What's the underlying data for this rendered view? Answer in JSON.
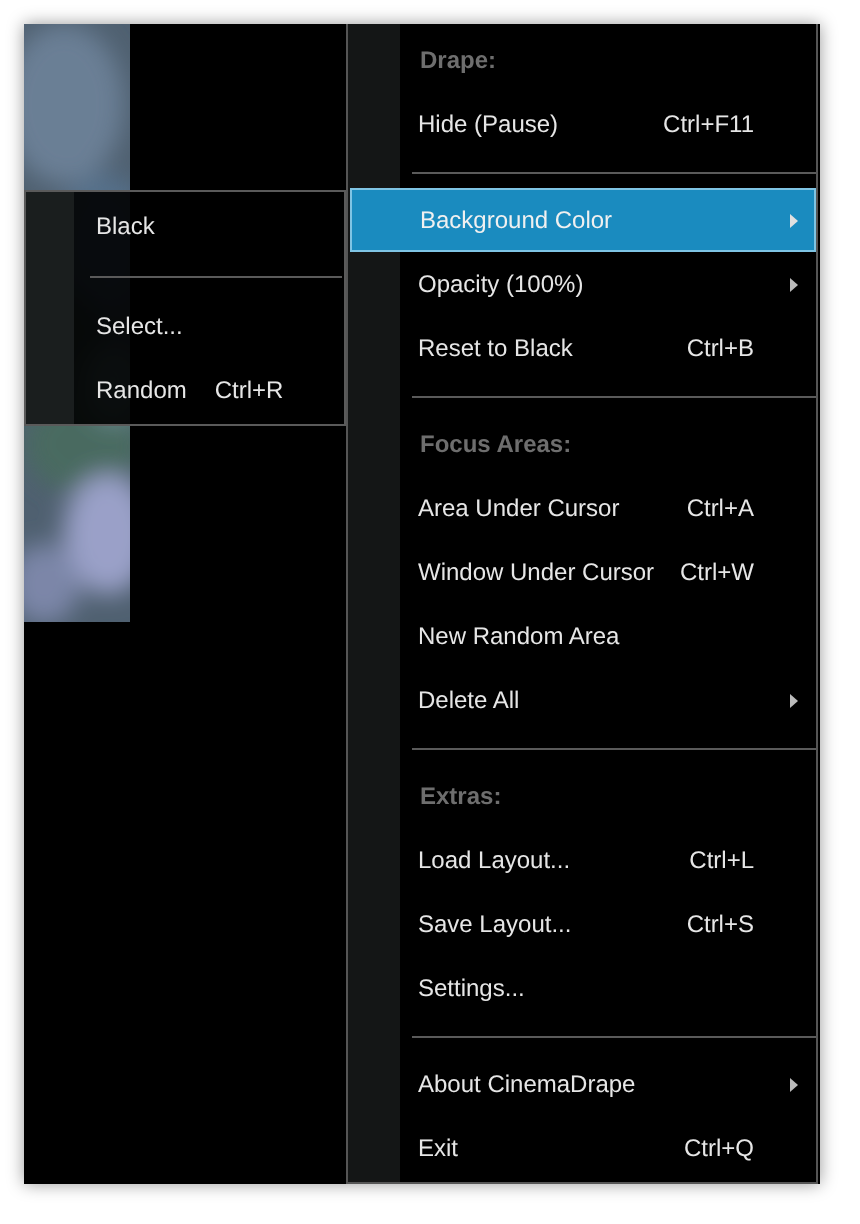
{
  "menu": [
    {
      "kind": "header",
      "label": "Drape:"
    },
    {
      "kind": "item",
      "label": "Hide (Pause)",
      "shortcut": "Ctrl+F11",
      "submenu": false,
      "selected": false
    },
    {
      "kind": "separator"
    },
    {
      "kind": "item",
      "label": "Background Color",
      "submenu": true,
      "selected": true
    },
    {
      "kind": "item",
      "label": "Opacity (100%)",
      "submenu": true,
      "selected": false
    },
    {
      "kind": "item",
      "label": "Reset to Black",
      "shortcut": "Ctrl+B",
      "submenu": false,
      "selected": false
    },
    {
      "kind": "separator"
    },
    {
      "kind": "header",
      "label": "Focus Areas:"
    },
    {
      "kind": "item",
      "label": "Area Under Cursor",
      "shortcut": "Ctrl+A",
      "submenu": false,
      "selected": false
    },
    {
      "kind": "item",
      "label": "Window Under Cursor",
      "shortcut": "Ctrl+W",
      "submenu": false,
      "selected": false
    },
    {
      "kind": "item",
      "label": "New Random Area",
      "submenu": false,
      "selected": false
    },
    {
      "kind": "item",
      "label": "Delete All",
      "submenu": true,
      "selected": false
    },
    {
      "kind": "separator"
    },
    {
      "kind": "header",
      "label": "Extras:"
    },
    {
      "kind": "item",
      "label": "Load Layout...",
      "shortcut": "Ctrl+L",
      "submenu": false,
      "selected": false
    },
    {
      "kind": "item",
      "label": "Save Layout...",
      "shortcut": "Ctrl+S",
      "submenu": false,
      "selected": false
    },
    {
      "kind": "item",
      "label": "Settings...",
      "submenu": false,
      "selected": false
    },
    {
      "kind": "separator"
    },
    {
      "kind": "item",
      "label": "About CinemaDrape",
      "submenu": true,
      "selected": false
    },
    {
      "kind": "item",
      "label": "Exit",
      "shortcut": "Ctrl+Q",
      "submenu": false,
      "selected": false
    }
  ],
  "submenu": [
    {
      "kind": "item",
      "label": "Black"
    },
    {
      "kind": "separator"
    },
    {
      "kind": "item",
      "label": "Select..."
    },
    {
      "kind": "item",
      "label": "Random",
      "shortcut": "Ctrl+R"
    }
  ]
}
